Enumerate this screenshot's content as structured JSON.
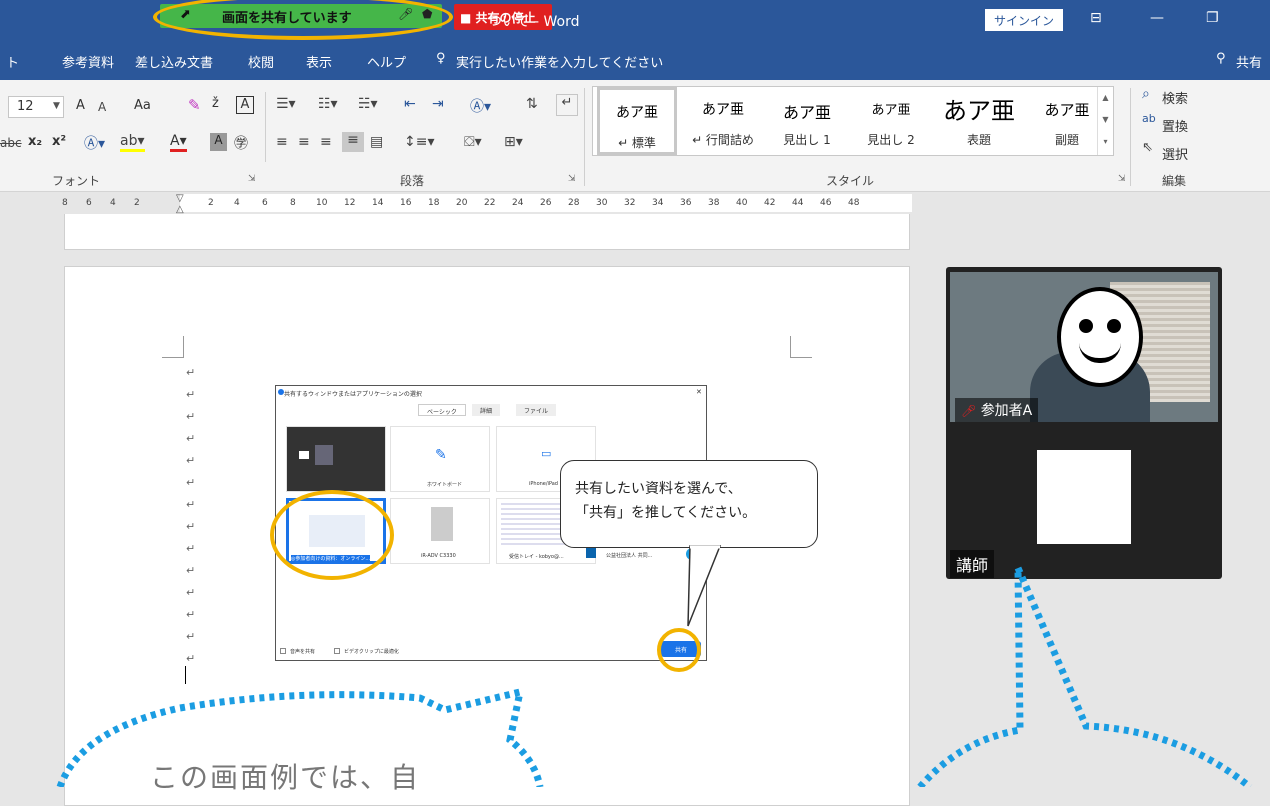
{
  "title_bar": {
    "title": "ついて - Word",
    "share_banner": "画面を共有しています",
    "stop_share": "■ 共有の停止",
    "signin": "サインイン",
    "ribbon_display_icon": "ribbon-display-icon",
    "minimize": "—",
    "restore": "❐"
  },
  "tabs": {
    "home_fragment": "ト",
    "items": [
      "参考資料",
      "差し込み文書",
      "校閲",
      "表示",
      "ヘルプ"
    ],
    "tell_me": "実行したい作業を入力してください",
    "share": "共有"
  },
  "ribbon": {
    "font": {
      "size": "12",
      "grow": "A",
      "shrink": "A",
      "case": "Aa",
      "strike": "abc",
      "subscript": "x₂",
      "superscript": "x²",
      "label": "フォント"
    },
    "paragraph": {
      "label": "段落"
    },
    "styles": {
      "label": "スタイル",
      "items": [
        {
          "sample": "あア亜",
          "name": "↵ 標準"
        },
        {
          "sample": "あア亜",
          "name": "↵ 行間詰め"
        },
        {
          "sample": "あア亜",
          "name": "見出し 1"
        },
        {
          "sample": "あア亜",
          "name": "見出し 2"
        },
        {
          "sample": "あア亜",
          "name": "表題"
        },
        {
          "sample": "あア亜",
          "name": "副題"
        }
      ]
    },
    "editing": {
      "label": "編集",
      "find": "検索",
      "replace": "置換",
      "select": "選択"
    }
  },
  "ruler": {
    "ticks": [
      "8",
      "6",
      "4",
      "2",
      "2",
      "4",
      "6",
      "8",
      "10",
      "12",
      "14",
      "16",
      "18",
      "20",
      "22",
      "24",
      "26",
      "28",
      "30",
      "32",
      "34",
      "36",
      "38",
      "40",
      "42",
      "44",
      "46",
      "48"
    ]
  },
  "dialog": {
    "title": "共有するウィンドウまたはアプリケーションの選択",
    "tabs": [
      "ベーシック",
      "詳細",
      "ファイル"
    ],
    "thumbs": [
      "",
      "ホワイトボード",
      "iPhone/iPad",
      "◎参加者向けの資料：オンライン...",
      "iR-ADV C3330",
      "受信トレイ - kobyo@...",
      "公益社団法人 共同..."
    ],
    "audio": "音声を共有",
    "video_opt": "ビデオクリップに最適化",
    "share_button": "共有"
  },
  "callout": {
    "line1": "共有したい資料を選んで、",
    "line2": "「共有」を推してください。"
  },
  "video": {
    "participant": "参加者A",
    "instructor": "講師"
  },
  "note": "この画面例では、自"
}
